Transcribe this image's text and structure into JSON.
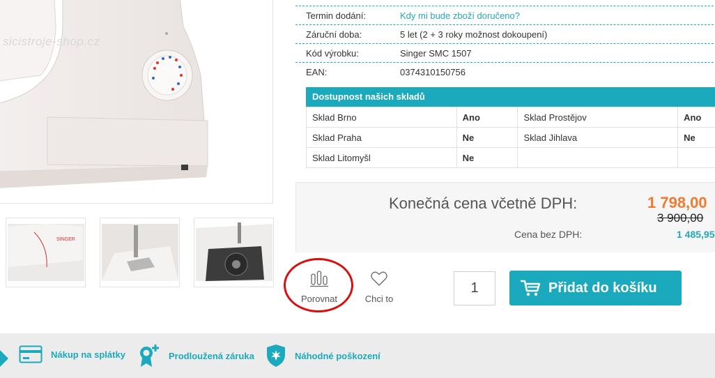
{
  "watermark": "sicistroje-shop.cz",
  "specs": [
    {
      "key": "Termin dodání:",
      "value": "Kdy mi bude zboží doručeno?",
      "link": true
    },
    {
      "key": "Záruční doba:",
      "value": "5 let (2 + 3 roky možnost dokoupení)",
      "link": false
    },
    {
      "key": "Kód výrobku:",
      "value": "Singer SMC 1507",
      "link": false
    },
    {
      "key": "EAN:",
      "value": "0374310150756",
      "link": false
    }
  ],
  "stock": {
    "title": "Dostupnost našich skladů",
    "rows": [
      {
        "a_name": "Sklad Brno",
        "a_val": "Ano",
        "b_name": "Sklad Prostějov",
        "b_val": "Ano"
      },
      {
        "a_name": "Sklad Praha",
        "a_val": "Ne",
        "b_name": "Sklad Jihlava",
        "b_val": "Ne"
      },
      {
        "a_name": "Sklad Litomyšl",
        "a_val": "Ne",
        "b_name": "",
        "b_val": ""
      }
    ]
  },
  "price": {
    "label": "Konečná cena včetně DPH:",
    "final": "1 798,00",
    "old": "3 900,00",
    "nodph_label": "Cena bez DPH:",
    "nodph": "1 485,95"
  },
  "actions": {
    "compare_label": "Porovnat",
    "wish_label": "Chci to",
    "quantity": "1",
    "add_to_cart": "Přidat do košíku"
  },
  "bottom_bar": {
    "items": [
      {
        "label": "Nákup na splátky",
        "icon": "card-icon"
      },
      {
        "label": "Prodloužená záruka",
        "icon": "warranty-icon"
      },
      {
        "label": "Náhodné poškození",
        "icon": "shield-icon"
      }
    ]
  },
  "colors": {
    "accent": "#1ba9bd",
    "price": "#f07a32",
    "highlight": "#d90f0f"
  }
}
